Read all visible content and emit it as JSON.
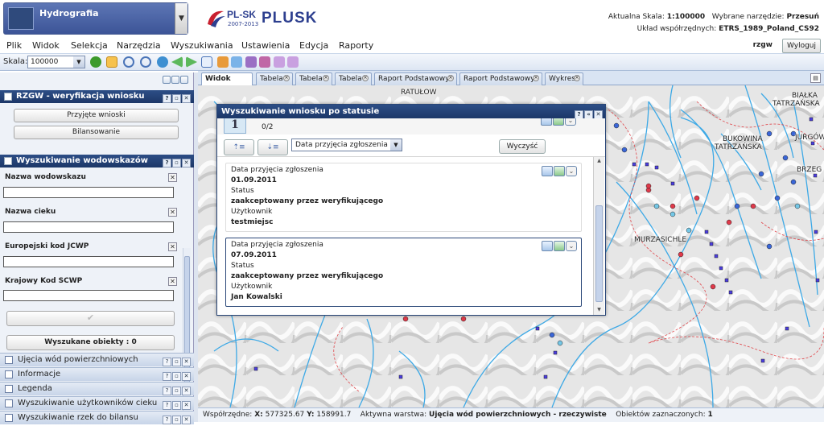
{
  "header": {
    "layer_name": "Hydrografia",
    "logo_plsk": "PL-SK",
    "logo_years": "2007-2013",
    "logo_plusk": "PLUSK",
    "current_scale_label": "Aktualna Skala:",
    "current_scale_value": "1:100000",
    "selected_tool_label": "Wybrane narzędzie:",
    "selected_tool_value": "Przesuń",
    "crs_label": "Układ współrzędnych:",
    "crs_value": "ETRS_1989_Poland_CS92",
    "user": "rzgw",
    "logout": "Wyloguj"
  },
  "menu": [
    "Plik",
    "Widok",
    "Selekcja",
    "Narzędzia",
    "Wyszukiwania",
    "Ustawienia",
    "Edycja",
    "Raporty"
  ],
  "toolbar": {
    "scale_label": "Skala:",
    "scale_value": "100000"
  },
  "sidebar": {
    "panel1_title": "RZGW - weryfikacja wniosku",
    "btn_accepted": "Przyjęte wnioski",
    "btn_balance": "Bilansowanie",
    "panel2_title": "Wyszukiwanie wodowskazów",
    "fields": [
      "Nazwa wodowskazu",
      "Nazwa cieku",
      "Europejski kod JCWP",
      "Krajowy Kod SCWP"
    ],
    "found_label": "Wyszukane obiekty : 0",
    "accordion": [
      "Ujęcia wód powierzchniowych",
      "Informacje",
      "Legenda",
      "Wyszukiwanie użytkowników cieku",
      "Wyszukiwanie rzek do bilansu"
    ]
  },
  "tabs": [
    {
      "label": "Widok mapy",
      "active": true
    },
    {
      "label": "Tabela"
    },
    {
      "label": "Tabela"
    },
    {
      "label": "Tabela"
    },
    {
      "label": "Raport Podstawowy"
    },
    {
      "label": "Raport Podstawowy"
    },
    {
      "label": "Wykres"
    }
  ],
  "map": {
    "labels": [
      "RATUŁOW",
      "BIAŁKA",
      "TATRZAŃSKA",
      "BUKOWINA",
      "TATRZAŃSKA",
      "JURGÓW",
      "BRZEG",
      "MURZASICHLE"
    ]
  },
  "dialog": {
    "title": "Wyszukiwanie wniosku po statusie",
    "page": "1",
    "count": "0/2",
    "sort_field": "Data przyjęcia zgłoszenia",
    "clear": "Wyczyść",
    "records": [
      {
        "date_label": "Data przyjęcia zgłoszenia",
        "date": "01.09.2011",
        "status_label": "Status",
        "status": "zaakceptowany przez weryfikującego",
        "user_label": "Użytkownik",
        "user": "testmiejsc"
      },
      {
        "date_label": "Data przyjęcia zgłoszenia",
        "date": "07.09.2011",
        "status_label": "Status",
        "status": "zaakceptowany przez weryfikującego",
        "user_label": "Użytkownik",
        "user": "Jan Kowalski"
      }
    ]
  },
  "status": {
    "coords_label": "Współrzędne:",
    "x_label": "X:",
    "x": "577325.67",
    "y_label": "Y:",
    "y": "158991.7",
    "layer_label": "Aktywna warstwa:",
    "layer": "Ujęcia wód powierzchniowych - rzeczywiste",
    "selected_label": "Obiektów zaznaczonych:",
    "selected": "1"
  }
}
